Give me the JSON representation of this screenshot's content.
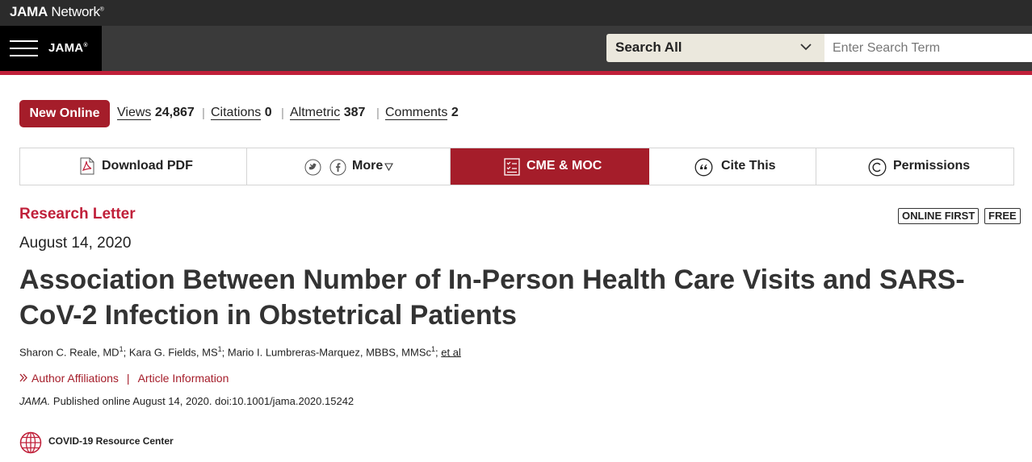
{
  "header": {
    "brand_bold": "JAMA",
    "brand_rest": " Network",
    "brand_tm": "®",
    "journal_logo": "JAMA",
    "journal_logo_mark": "®",
    "search_scope": "Search All",
    "search_placeholder": "Enter Search Term"
  },
  "stats": {
    "badge": "New Online",
    "views_label": "Views",
    "views_value": "24,867",
    "citations_label": "Citations",
    "citations_value": "0",
    "altmetric_label": "Altmetric",
    "altmetric_value": "387",
    "comments_label": "Comments",
    "comments_value": "2"
  },
  "toolbar": {
    "download_pdf": "Download PDF",
    "more": "More",
    "cme_moc": "CME & MOC",
    "cite_this": "Cite This",
    "permissions": "Permissions"
  },
  "article": {
    "type": "Research Letter",
    "badge_online_first": "ONLINE FIRST",
    "badge_free": "FREE",
    "date": "August 14, 2020",
    "title": "Association Between Number of In-Person Health Care Visits and SARS-CoV-2 Infection in Obstetrical Patients",
    "authors": [
      {
        "name": "Sharon C. Reale, MD",
        "sup": "1",
        "sep": "; "
      },
      {
        "name": "Kara G. Fields, MS",
        "sup": "1",
        "sep": "; "
      },
      {
        "name": "Mario I. Lumbreras-Marquez, MBBS, MMSc",
        "sup": "1",
        "sep": "; "
      }
    ],
    "et_al": "et al",
    "author_affiliations": "Author Affiliations",
    "article_information": "Article Information",
    "citation_journal": "JAMA.",
    "citation_rest": " Published online August 14, 2020. doi:10.1001/jama.2020.15242",
    "resource_center": "COVID-19 Resource Center"
  },
  "colors": {
    "accent_red": "#a51d2a",
    "line_red": "#c0203a",
    "topbar": "#2b2b2b",
    "navbar": "#3a3a3a"
  }
}
